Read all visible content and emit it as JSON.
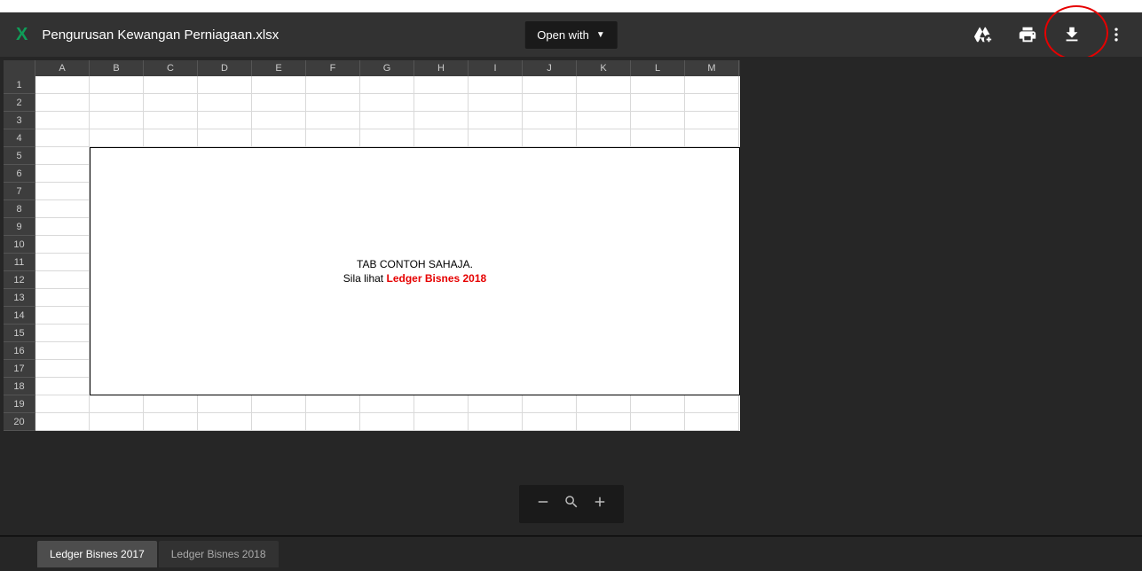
{
  "header": {
    "app_icon_letter": "X",
    "file_title": "Pengurusan Kewangan Perniagaan.xlsx",
    "open_with_label": "Open with"
  },
  "columns": [
    "A",
    "B",
    "C",
    "D",
    "E",
    "F",
    "G",
    "H",
    "I",
    "J",
    "K",
    "L",
    "M"
  ],
  "rows": [
    "1",
    "2",
    "3",
    "4",
    "5",
    "6",
    "7",
    "8",
    "9",
    "10",
    "11",
    "12",
    "13",
    "14",
    "15",
    "16",
    "17",
    "18",
    "19",
    "20"
  ],
  "overlay": {
    "line1": "TAB CONTOH SAHAJA.",
    "line2_prefix": "Sila lihat ",
    "line2_red": "Ledger Bisnes 2018"
  },
  "tabs": [
    {
      "label": "Ledger Bisnes 2017",
      "active": true
    },
    {
      "label": "Ledger Bisnes 2018",
      "active": false
    }
  ]
}
